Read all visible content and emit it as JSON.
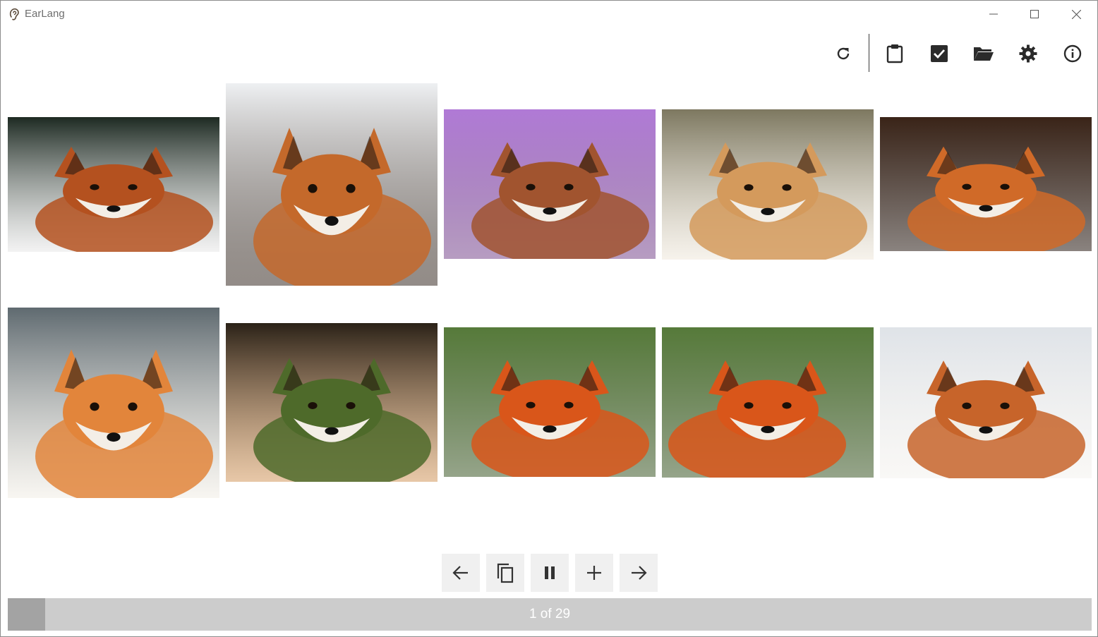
{
  "window": {
    "title": "EarLang",
    "icons": {
      "app": "ear-icon",
      "minimize": "minimize-icon",
      "maximize": "maximize-icon",
      "close": "close-icon"
    }
  },
  "toolbar": [
    {
      "name": "refresh",
      "icon": "refresh-icon"
    },
    {
      "name": "clipboard",
      "icon": "clipboard-icon"
    },
    {
      "name": "check",
      "icon": "checkbox-checked-icon"
    },
    {
      "name": "open-folder",
      "icon": "folder-open-icon"
    },
    {
      "name": "settings",
      "icon": "gear-icon"
    },
    {
      "name": "info",
      "icon": "info-icon"
    }
  ],
  "images": [
    {
      "kind": "red fox",
      "palette": [
        "#1d2a22",
        "#b4511f",
        "#e8e8e8"
      ]
    },
    {
      "kind": "red fox in snow",
      "palette": [
        "#eef0f2",
        "#c4692b",
        "#3a2e26"
      ]
    },
    {
      "kind": "red fox purple tint",
      "palette": [
        "#b07ad6",
        "#a1542f",
        "#7b4c8f"
      ]
    },
    {
      "kind": "fox kit",
      "palette": [
        "#7d7860",
        "#d49a5c",
        "#efe8dc"
      ]
    },
    {
      "kind": "red fox standing",
      "palette": [
        "#3a2418",
        "#d06a28",
        "#2a1d16"
      ]
    },
    {
      "kind": "red fox portrait",
      "palette": [
        "#5f6a70",
        "#e2853b",
        "#f2eee6"
      ]
    },
    {
      "kind": "fox lying in forest",
      "palette": [
        "#2b2218",
        "#4e6a2a",
        "#d49a60"
      ]
    },
    {
      "kind": "red fox close-up",
      "palette": [
        "#567a3a",
        "#d9561a",
        "#3f5a2a"
      ]
    },
    {
      "kind": "red fox close-up mirrored",
      "palette": [
        "#567a3a",
        "#d9561a",
        "#3f5a2a"
      ]
    },
    {
      "kind": "red fox on snow",
      "palette": [
        "#dfe3e8",
        "#c7642a",
        "#f4f2ee"
      ]
    }
  ],
  "controls": [
    {
      "name": "previous",
      "icon": "arrow-left-icon"
    },
    {
      "name": "copy",
      "icon": "copy-icon"
    },
    {
      "name": "pause",
      "icon": "pause-icon"
    },
    {
      "name": "add",
      "icon": "plus-icon"
    },
    {
      "name": "next",
      "icon": "arrow-right-icon"
    }
  ],
  "progress": {
    "current": 1,
    "total": 29,
    "label": "1 of 29",
    "fill_fraction": 0.0345,
    "colors": {
      "track": "#cccccc",
      "fill": "#a3a3a3",
      "text": "#ffffff"
    }
  }
}
